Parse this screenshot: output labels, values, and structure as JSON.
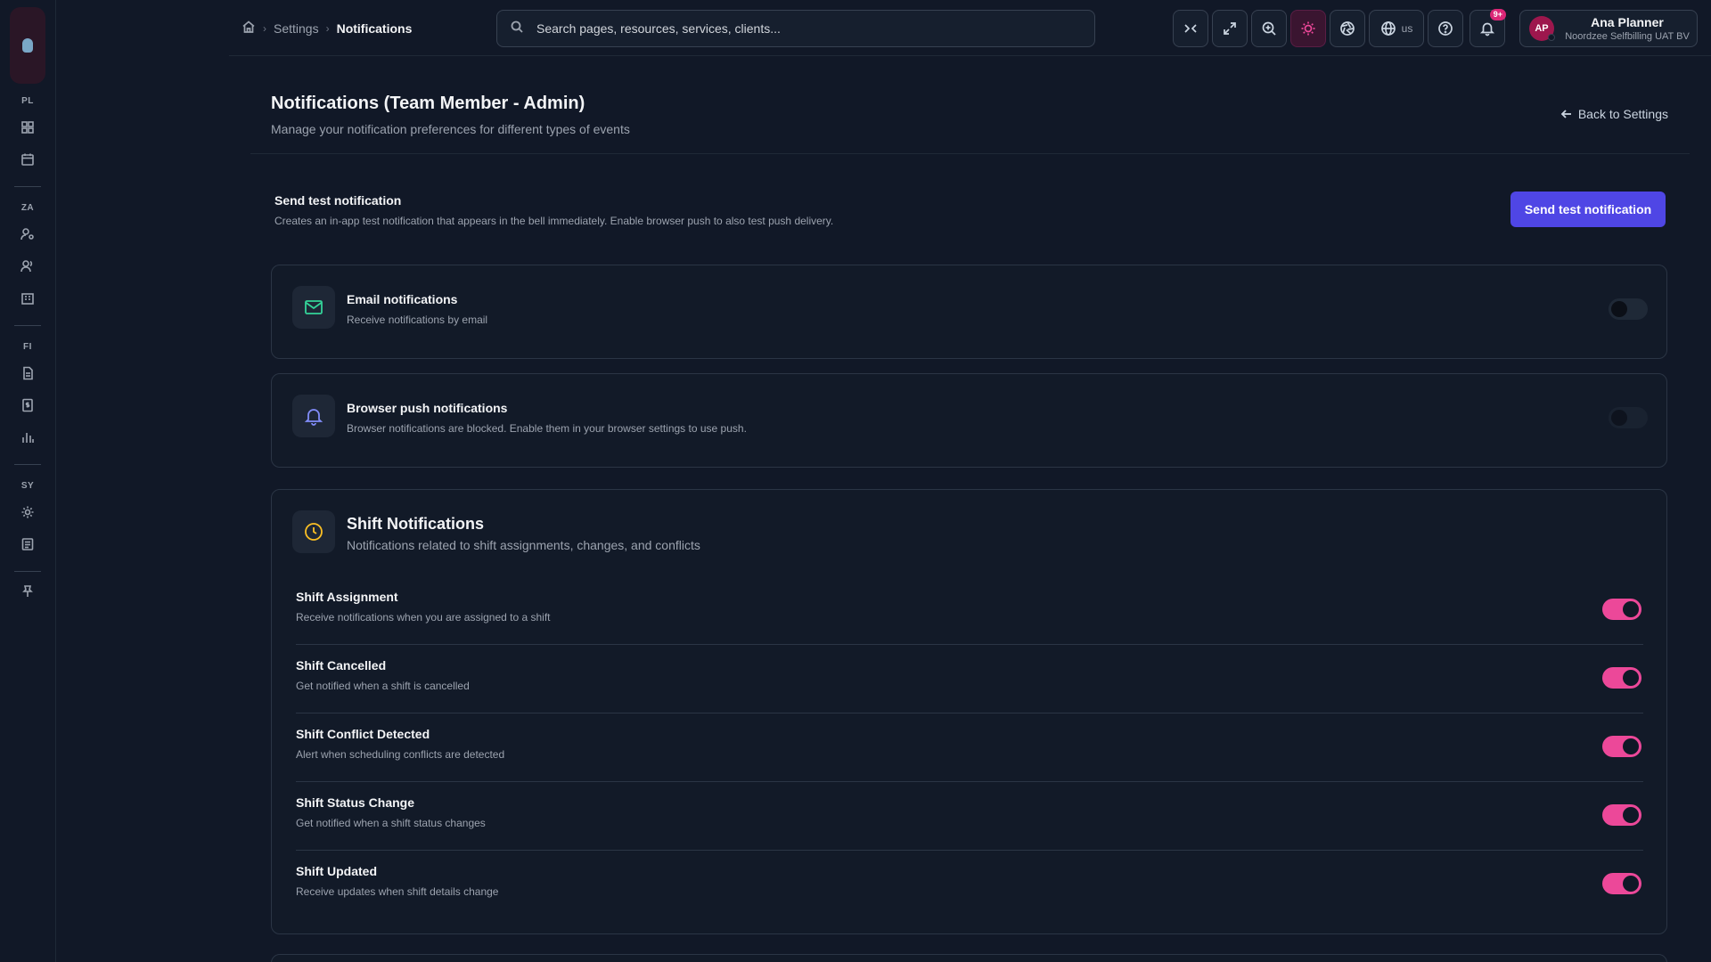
{
  "breadcrumb": {
    "items": [
      "Settings",
      "Notifications"
    ]
  },
  "search": {
    "placeholder": "Search pages, resources, services, clients..."
  },
  "toolbar": {
    "language": "us",
    "notification_badge": "9+"
  },
  "user": {
    "initials": "AP",
    "name": "Ana Planner",
    "organization": "Noordzee Selfbilling UAT BV"
  },
  "rail": {
    "sections": [
      "PL",
      "ZA",
      "FI",
      "SY"
    ]
  },
  "page": {
    "title": "Notifications (Team Member - Admin)",
    "subtitle": "Manage your notification preferences for different types of events",
    "back_label": "Back to Settings"
  },
  "test": {
    "title": "Send test notification",
    "description": "Creates an in-app test notification that appears in the bell immediately. Enable browser push to also test push delivery.",
    "button_label": "Send test notification"
  },
  "email": {
    "title": "Email notifications",
    "description": "Receive notifications by email",
    "enabled": false
  },
  "push": {
    "title": "Browser push notifications",
    "description": "Browser notifications are blocked. Enable them in your browser settings to use push.",
    "enabled": false
  },
  "shift": {
    "title": "Shift Notifications",
    "description": "Notifications related to shift assignments, changes, and conflicts",
    "items": [
      {
        "title": "Shift Assignment",
        "description": "Receive notifications when you are assigned to a shift",
        "enabled": true
      },
      {
        "title": "Shift Cancelled",
        "description": "Get notified when a shift is cancelled",
        "enabled": true
      },
      {
        "title": "Shift Conflict Detected",
        "description": "Alert when scheduling conflicts are detected",
        "enabled": true
      },
      {
        "title": "Shift Status Change",
        "description": "Get notified when a shift status changes",
        "enabled": true
      },
      {
        "title": "Shift Updated",
        "description": "Receive updates when shift details change",
        "enabled": true
      }
    ]
  },
  "colors": {
    "accent": "#ec4899",
    "primary_button": "#4f46e5",
    "email_icon": "#34d399",
    "push_icon": "#818cf8",
    "shift_icon": "#fbbf24"
  }
}
